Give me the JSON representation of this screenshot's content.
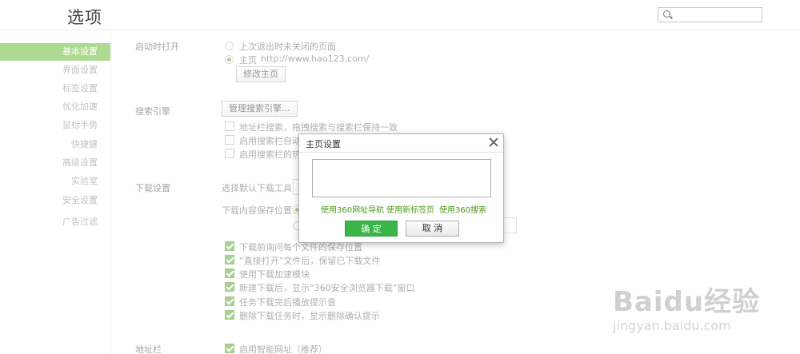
{
  "header": {
    "title": "选项",
    "search_placeholder": ""
  },
  "sidebar": {
    "items": [
      {
        "label": "基本设置",
        "active": true
      },
      {
        "label": "界面设置"
      },
      {
        "label": "标签设置"
      },
      {
        "label": "优化加速"
      },
      {
        "label": "鼠标手势"
      },
      {
        "label": "快捷键"
      },
      {
        "label": "高级设置"
      },
      {
        "label": "实验室"
      },
      {
        "label": "安全设置"
      },
      {
        "label": "广告过滤"
      }
    ]
  },
  "startup": {
    "label": "启动时打开",
    "option_last": "上次退出时未关闭的页面",
    "option_home": "主页",
    "home_url": "http://www.hao123.com/",
    "change_home_button": "修改主页"
  },
  "search_engine": {
    "label": "搜索引擎",
    "manage_button": "管理搜索引擎...",
    "opt1": "地址栏搜索，拖拽搜索与搜索栏保持一致",
    "opt2": "启用搜索栏自动提",
    "opt3": "启用搜索栏的热搜"
  },
  "download": {
    "label": "下载设置",
    "default_tool_label": "选择默认下载工具：",
    "save_location_label": "下载内容保存位置：",
    "opt1": "下载前询问每个文件的保存位置",
    "opt2": "“直接打开”文件后，保留已下载文件",
    "opt3": "使用下载加速模块",
    "opt4": "新建下载后，显示“360安全浏览器下载”窗口",
    "opt5": "任务下载完后播放提示音",
    "opt6": "删除下载任务时，显示删除确认提示"
  },
  "addressbar": {
    "label": "地址栏",
    "opt1": "启用智能网址（推荐）"
  },
  "dialog": {
    "title": "主页设置",
    "textarea_value": "",
    "link_360nav": "使用360网址导航",
    "link_newtab": "使用新标签页",
    "link_360search": "使用360搜索",
    "ok_label": "确 定",
    "cancel_label": "取 消"
  },
  "watermark": {
    "text": "Baidu经验",
    "sub": "jingyan.baidu.com"
  },
  "colors": {
    "accent": "#65b82e",
    "ok_button": "#39b54a",
    "link": "#4e9a1a"
  }
}
